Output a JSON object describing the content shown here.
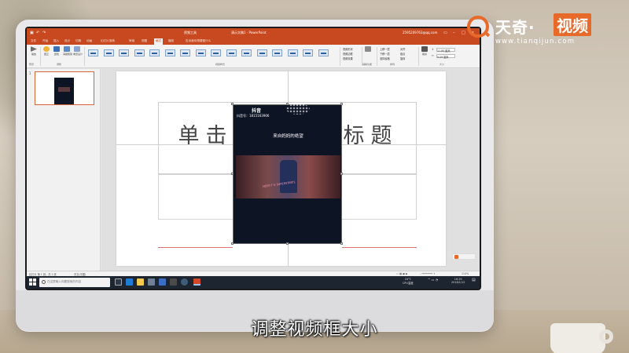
{
  "watermark": {
    "name_part1": "天奇·",
    "name_part2": "视频",
    "url": "www.tianqijun.com"
  },
  "subtitle": "调整视频框大小",
  "app": {
    "context_label": "视频工具",
    "title": "演示文稿1 - PowerPoint",
    "account": "2595209763@qq.com",
    "tabs": [
      "文件",
      "开始",
      "插入",
      "设计",
      "切换",
      "动画",
      "幻灯片放映",
      "审阅",
      "视图",
      "格式",
      "播放"
    ],
    "active_tab": "格式",
    "tell_me": "告诉我你想要做什么"
  },
  "ribbon": {
    "buttons": [
      {
        "label": "播放",
        "group": "预览"
      },
      {
        "label": "更正"
      },
      {
        "label": "颜色"
      },
      {
        "label": "海报框架"
      },
      {
        "label": "重置设计"
      }
    ],
    "groups": [
      "预览",
      "调整",
      "视频样式",
      "辅助功能",
      "排列",
      "大小"
    ],
    "right_items": [
      "视频形状",
      "视频边框",
      "视频效果",
      "上移一层",
      "下移一层",
      "选择窗格",
      "对齐",
      "组合",
      "旋转",
      "裁剪"
    ],
    "size": {
      "height": "11.84 厘米",
      "width": "9.09 厘米"
    }
  },
  "thumbnails": [
    {
      "number": "1"
    }
  ],
  "slide": {
    "title_placeholder": "单击此处添加标题"
  },
  "video": {
    "app_logo": "抖音",
    "account_id": "抖音号：1815163906",
    "caption": "来自妈妈的绝望",
    "neon": "NEED F U SUPERSTARTL"
  },
  "statusbar": {
    "slide_info": "幻灯片 第 1 张，共 1 张",
    "language": "中文(中国)",
    "zoom": "114%"
  },
  "taskbar": {
    "search_placeholder": "在这里输入你要搜索的内容",
    "weather_temp": "16°C",
    "weather_label": "CPU温度",
    "time": "16:29",
    "date": "2018/1/12"
  }
}
